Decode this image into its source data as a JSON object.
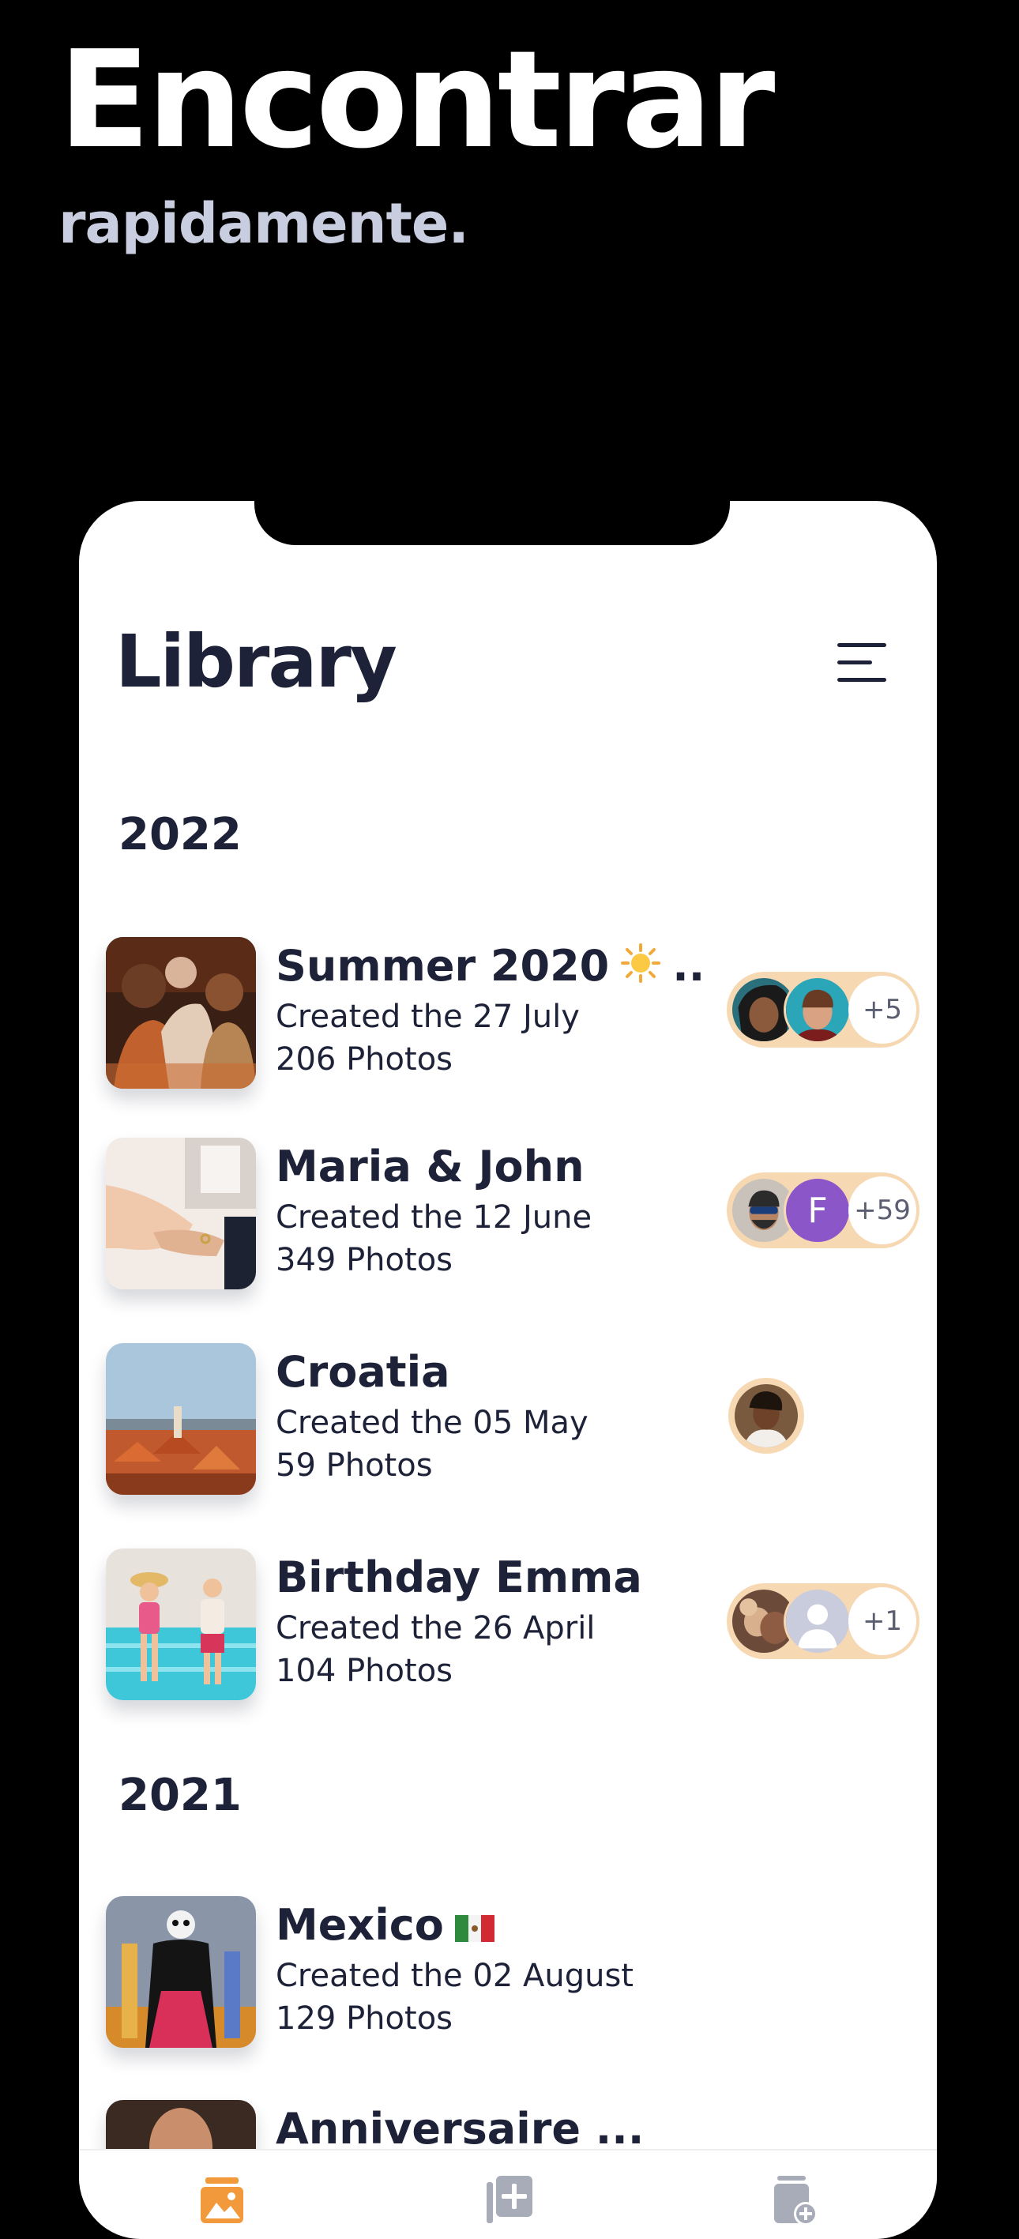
{
  "hero": {
    "title": "Encontrar",
    "subtitle": "rapidamente."
  },
  "header": {
    "title": "Library",
    "menu_icon": "hamburger-menu-icon"
  },
  "sections": [
    {
      "year": "2022",
      "albums": [
        {
          "name": "Summer 2020",
          "emoji": "sun-emoji",
          "ellipsis": "...",
          "date": "Created the 27 July",
          "count": "206 Photos",
          "more": "+5"
        },
        {
          "name": "Maria & John",
          "date": "Created the 12 June",
          "count": "349 Photos",
          "letter": "F",
          "more": "+59"
        },
        {
          "name": "Croatia",
          "date": "Created the 05 May",
          "count": "59 Photos"
        },
        {
          "name": "Birthday Emma",
          "date": "Created the 26 April",
          "count": "104 Photos",
          "more": "+1"
        }
      ]
    },
    {
      "year": "2021",
      "albums": [
        {
          "name": "Mexico",
          "emoji": "mexico-flag-emoji",
          "date": "Created the 02 August",
          "count": "129 Photos"
        },
        {
          "name": "Anniversaire ..."
        }
      ]
    }
  ],
  "tabbar": {
    "tabs": [
      "library-tab-icon",
      "add-album-tab-icon",
      "shared-albums-tab-icon"
    ]
  },
  "colors": {
    "background": "#000000",
    "card": "#ffffff",
    "text_dark": "#1e2238",
    "subtitle": "#c9cde0",
    "accent_orange": "#f29a3b",
    "member_pill": "#f6d9b3",
    "tab_inactive": "#a8acb8"
  }
}
